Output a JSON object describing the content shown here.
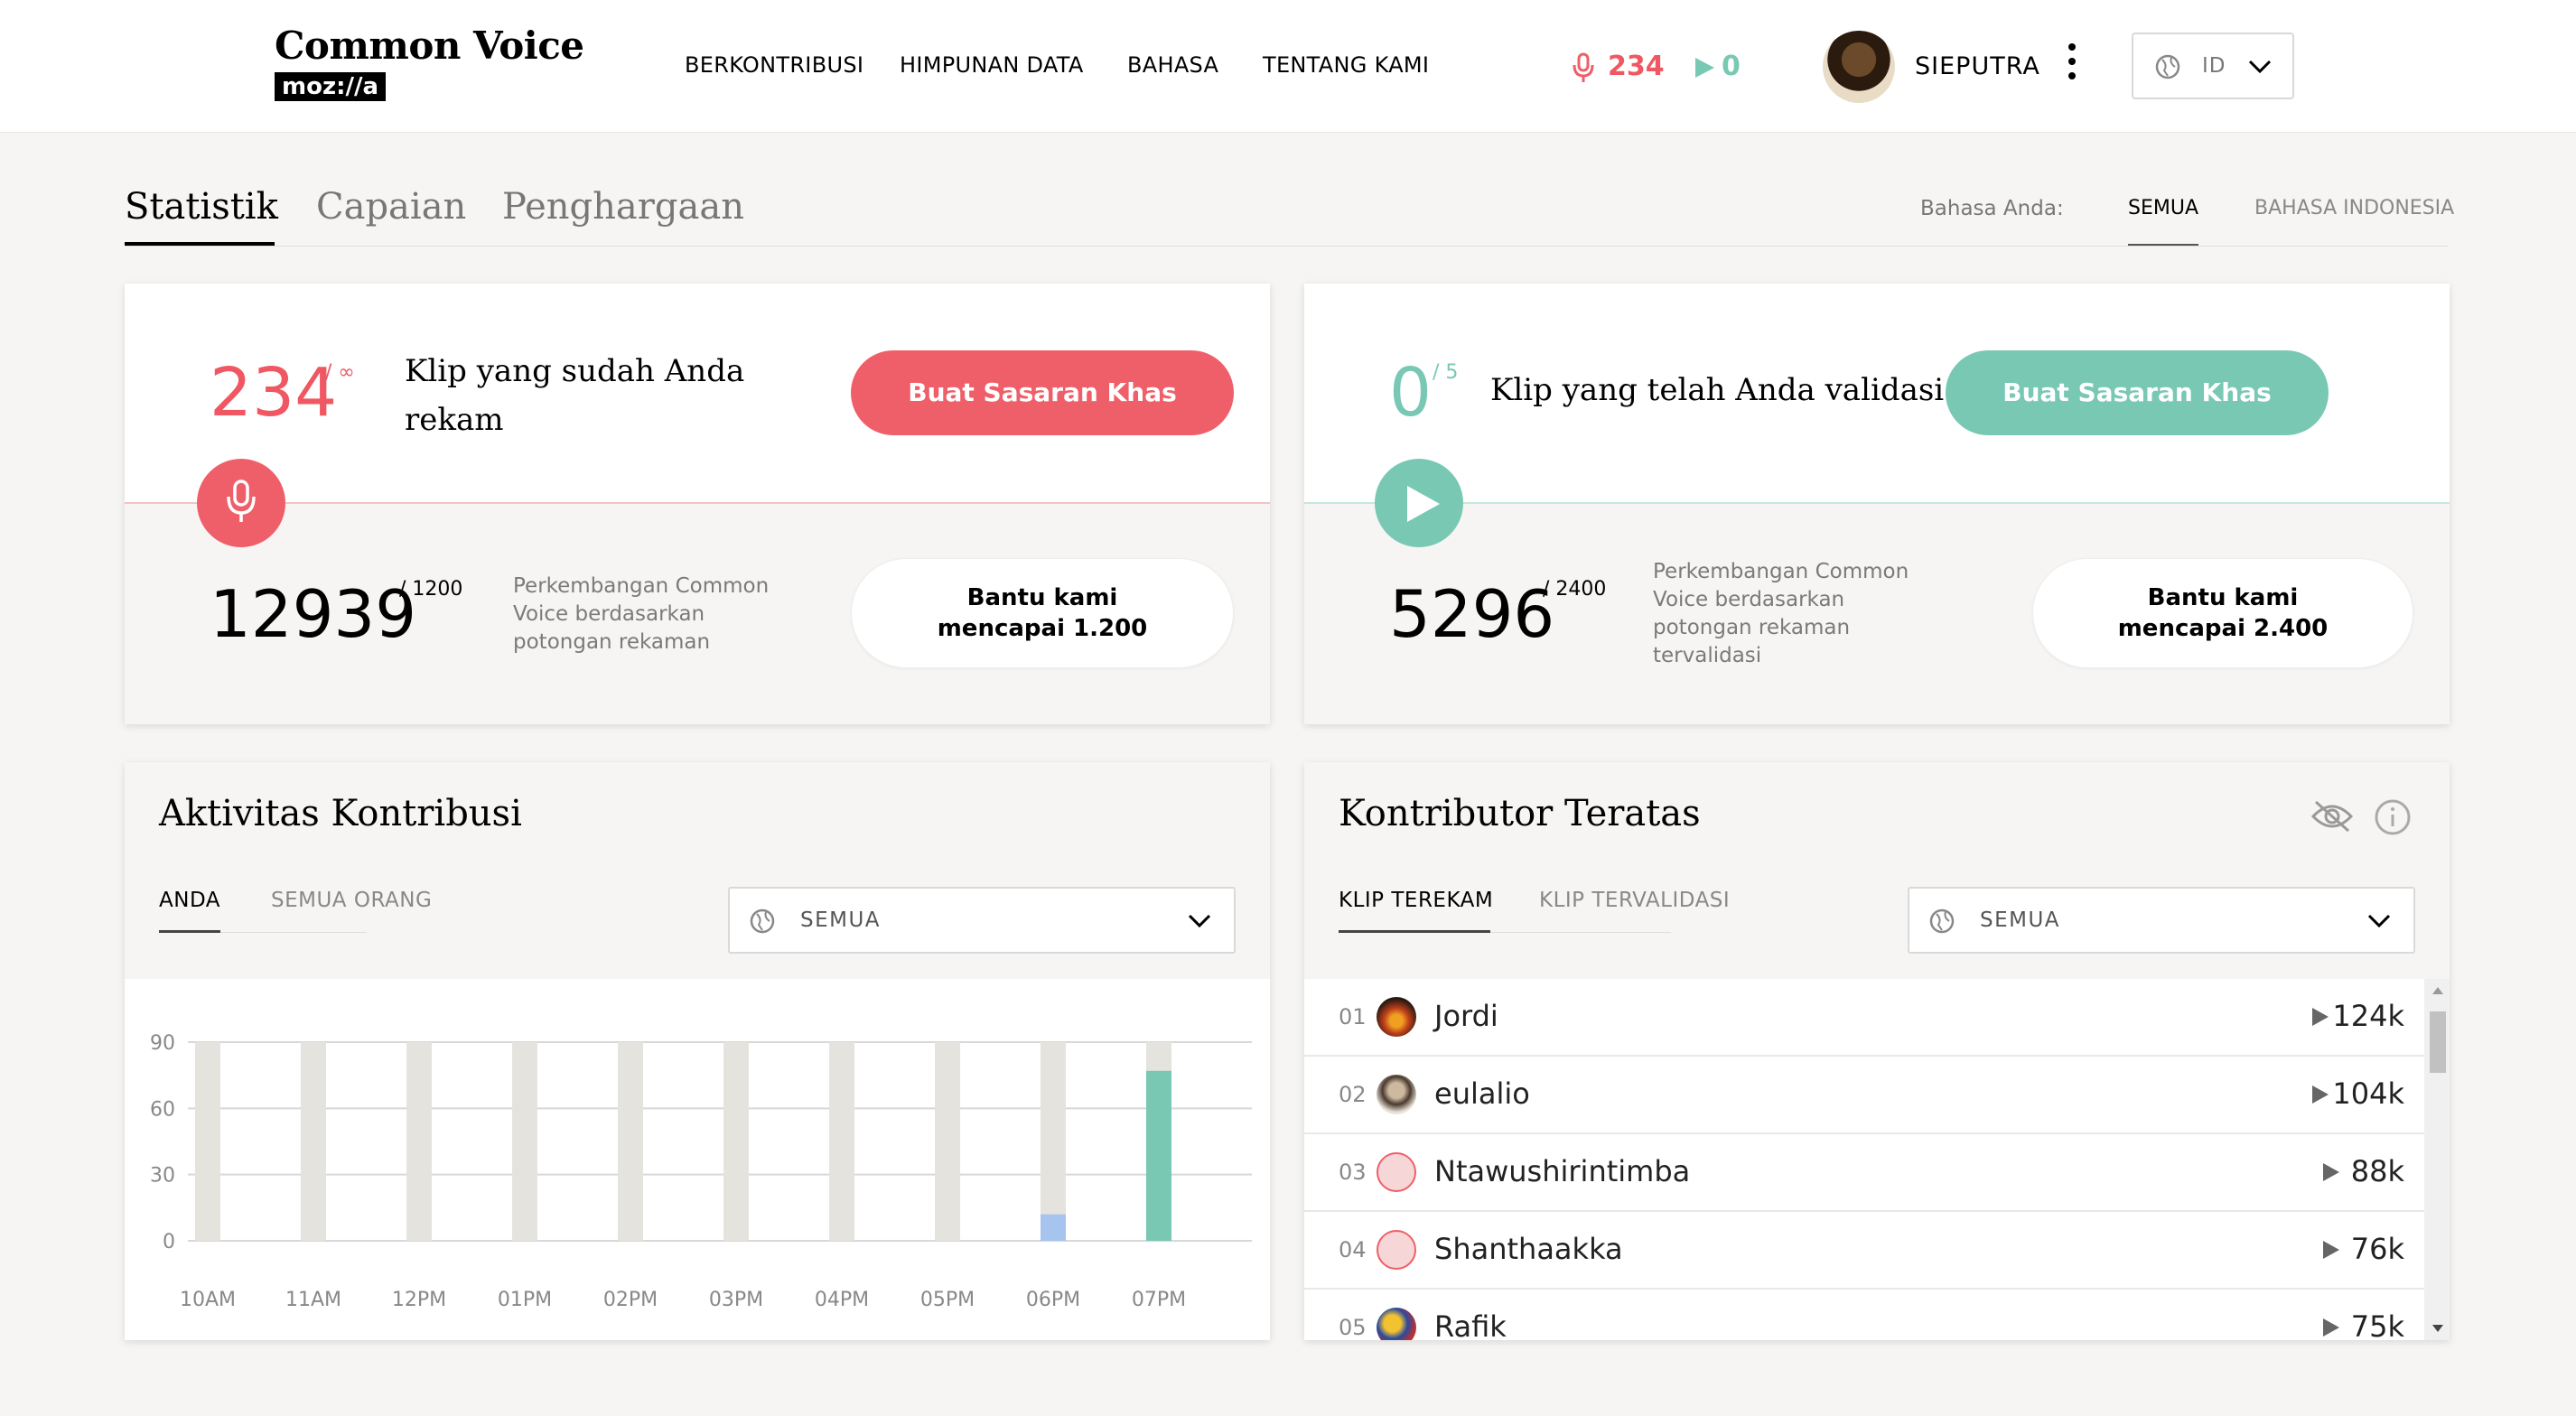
{
  "header": {
    "logo_title": "Common Voice",
    "logo_badge": "moz://a",
    "nav": [
      "BERKONTRIBUSI",
      "HIMPUNAN DATA",
      "BAHASA",
      "TENTANG KAMI"
    ],
    "recorded_count": "234",
    "validated_count": "0",
    "username": "SIEPUTRA",
    "locale": "ID"
  },
  "tabs": {
    "items": [
      "Statistik",
      "Capaian",
      "Penghargaan"
    ],
    "active": "Statistik",
    "language_label": "Bahasa Anda:",
    "language_options": [
      "SEMUA",
      "BAHASA INDONESIA"
    ],
    "language_active": "SEMUA"
  },
  "record_card": {
    "count": "234",
    "goal": "/ ∞",
    "label": "Klip yang sudah Anda rekam",
    "button": "Buat Sasaran Khas",
    "community_count": "12939",
    "community_goal": "/ 1200",
    "community_desc": "Perkembangan Common Voice berdasarkan potongan rekaman",
    "help_button": "Bantu kami mencapai 1.200"
  },
  "validate_card": {
    "count": "0",
    "goal": "/ 5",
    "label": "Klip yang telah Anda validasi",
    "button": "Buat Sasaran Khas",
    "community_count": "5296",
    "community_goal": "/ 2400",
    "community_desc": "Perkembangan Common Voice berdasarkan potongan rekaman tervalidasi",
    "help_button": "Bantu kami mencapai 2.400"
  },
  "activity": {
    "title": "Aktivitas Kontribusi",
    "tabs": [
      "ANDA",
      "SEMUA ORANG"
    ],
    "active_tab": "ANDA",
    "filter": "SEMUA"
  },
  "leaderboard": {
    "title": "Kontributor Teratas",
    "tabs": [
      "KLIP TEREKAM",
      "KLIP TERVALIDASI"
    ],
    "active_tab": "KLIP TEREKAM",
    "filter": "SEMUA",
    "rows": [
      {
        "rank": "01",
        "name": "Jordi",
        "value": "124k"
      },
      {
        "rank": "02",
        "name": "eulalio",
        "value": "104k"
      },
      {
        "rank": "03",
        "name": "Ntawushirintimba",
        "value": "88k"
      },
      {
        "rank": "04",
        "name": "Shanthaakka",
        "value": "76k"
      },
      {
        "rank": "05",
        "name": "Rafik",
        "value": "75k"
      }
    ]
  },
  "colors": {
    "record": "#ef5f69",
    "validate": "#78c8b4",
    "bar_bg": "#e5e3de",
    "bar_recorded": "#78c8b4",
    "bar_validated": "#a7c4ef"
  },
  "chart_data": {
    "type": "bar",
    "categories": [
      "10AM",
      "11AM",
      "12PM",
      "01PM",
      "02PM",
      "03PM",
      "04PM",
      "05PM",
      "06PM",
      "07PM"
    ],
    "series": [
      {
        "values": [
          0,
          0,
          0,
          0,
          0,
          0,
          0,
          0,
          0,
          77
        ]
      },
      {
        "values": [
          0,
          0,
          0,
          0,
          0,
          0,
          0,
          0,
          12,
          0
        ]
      }
    ],
    "yticks": [
      0,
      30,
      60,
      90
    ],
    "ylim": [
      0,
      90
    ],
    "grid": true,
    "stacked": false
  }
}
